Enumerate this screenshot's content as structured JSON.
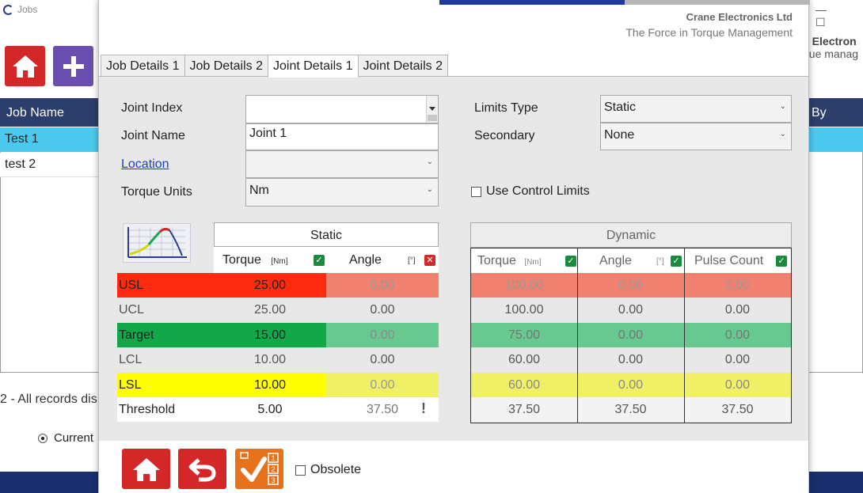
{
  "background": {
    "title": "Jobs",
    "header_cols": [
      "Job Name",
      "By"
    ],
    "rows": [
      "Test 1",
      "test 2"
    ],
    "records_text": "2 - All records dis",
    "radio_label": "Current",
    "brand_line1": "e Electron",
    "brand_line2": "que manag"
  },
  "dialog": {
    "company": "Crane Electronics Ltd",
    "tagline": "The Force in Torque Management",
    "tabs": [
      "Job Details 1",
      "Job Details 2",
      "Joint Details 1",
      "Joint Details 2"
    ],
    "active_tab": "Joint Details 1",
    "form": {
      "joint_index_label": "Joint Index",
      "joint_index_value": "",
      "joint_name_label": "Joint Name",
      "joint_name_value": "Joint 1",
      "location_label": "Location",
      "location_value": "",
      "torque_units_label": "Torque Units",
      "torque_units_value": "Nm",
      "limits_type_label": "Limits Type",
      "limits_type_value": "Static",
      "secondary_label": "Secondary",
      "secondary_value": "None",
      "use_control_limits_label": "Use Control Limits",
      "use_control_limits_checked": false
    },
    "static": {
      "title": "Static",
      "torque_header": "Torque",
      "torque_unit": "[Nm]",
      "torque_enabled": true,
      "angle_header": "Angle",
      "angle_unit": "[°]",
      "angle_enabled": false,
      "warning_mark": "!",
      "rows": [
        {
          "name": "USL",
          "torque": "25.00",
          "angle": "0.00"
        },
        {
          "name": "UCL",
          "torque": "25.00",
          "angle": "0.00"
        },
        {
          "name": "Target",
          "torque": "15.00",
          "angle": "0.00"
        },
        {
          "name": "LCL",
          "torque": "10.00",
          "angle": "0.00"
        },
        {
          "name": "LSL",
          "torque": "10.00",
          "angle": "0.00"
        },
        {
          "name": "Threshold",
          "torque": "5.00",
          "angle": "37.50"
        }
      ]
    },
    "dynamic": {
      "title": "Dynamic",
      "torque_header": "Torque",
      "torque_unit": "[Nm]",
      "angle_header": "Angle",
      "angle_unit": "[°]",
      "pulse_header": "Pulse Count",
      "rows": [
        {
          "torque": "100.00",
          "angle": "0.00",
          "pulse": "0.00"
        },
        {
          "torque": "100.00",
          "angle": "0.00",
          "pulse": "0.00"
        },
        {
          "torque": "75.00",
          "angle": "0.00",
          "pulse": "0.00"
        },
        {
          "torque": "60.00",
          "angle": "0.00",
          "pulse": "0.00"
        },
        {
          "torque": "60.00",
          "angle": "0.00",
          "pulse": "0.00"
        },
        {
          "torque": "37.50",
          "angle": "37.50",
          "pulse": "37.50"
        }
      ]
    },
    "footer": {
      "obsolete_label": "Obsolete",
      "obsolete_checked": false,
      "save_badges": [
        "1",
        "2",
        "3"
      ]
    },
    "colors": {
      "usl": "#ff2a10",
      "usl_light": "#f2806e",
      "target": "#12a84a",
      "target_light": "#67c98f",
      "lsl": "#ffff00",
      "lsl_light": "#f0f067",
      "accent_blue": "#1f3b99"
    }
  }
}
